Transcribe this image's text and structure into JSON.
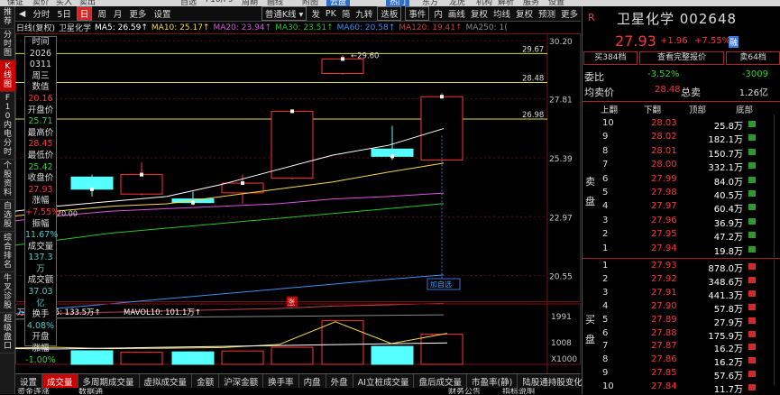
{
  "top_strip": [
    "保证",
    "卖价",
    "买入",
    "卖出",
    "自选",
    "F10/F9",
    "周期",
    "画线",
    "附图",
    "云盘",
    "热门",
    "东方",
    "龙虎",
    "机构",
    "解析",
    "服务",
    "设置"
  ],
  "left_sidebar": [
    "推荐",
    "分时图",
    "K线图",
    "F10内电分时",
    "个股资料",
    "自选股",
    "综合排名",
    "牛叉诊股",
    "超级盘口"
  ],
  "toolbar": {
    "items": [
      "◀",
      "分时",
      "5日",
      "日",
      "周",
      "月",
      "更多",
      "设置"
    ],
    "selected": "日",
    "fq": "普通K线",
    "right": [
      "发",
      "PK",
      "简",
      "九转",
      "迭板",
      "事件",
      "内",
      "画线",
      "复权",
      "均线",
      "复权",
      "预测",
      "更多"
    ]
  },
  "indicators": {
    "label": "日线(复权)",
    "name": "卫星化学",
    "items": [
      {
        "t": "MA5: 26.59↑",
        "c": "#ffffff"
      },
      {
        "t": "MA10: 25.17↑",
        "c": "#f5d84a"
      },
      {
        "t": "MA20: 23.94↑",
        "c": "#e050e0"
      },
      {
        "t": "MA30: 23.51↑",
        "c": "#27c427"
      },
      {
        "t": "MA60: 20.58↑",
        "c": "#3d8ef0"
      },
      {
        "t": "MA120: 19.41↑",
        "c": "#c84040"
      },
      {
        "t": "MA250: 1(",
        "c": "#888888"
      }
    ]
  },
  "price_axis": [
    "30.20",
    "27.81",
    "25.39",
    "22.97",
    "20.55"
  ],
  "price_lines": [
    {
      "label": "29.67",
      "value": 29.67
    },
    {
      "label": "28.48",
      "value": 28.48
    },
    {
      "label": "26.98",
      "value": 26.98
    }
  ],
  "annotations": {
    "high": "29.60",
    "low": "20.00",
    "limit": "涨",
    "add_watch": "加自选"
  },
  "chart_data": {
    "type": "candlestick",
    "candles": [
      {
        "o": 24.6,
        "c": 24.1,
        "h": 24.7,
        "l": 23.8
      },
      {
        "o": 23.9,
        "c": 24.7,
        "h": 25.2,
        "l": 23.85
      },
      {
        "o": 23.7,
        "c": 23.55,
        "h": 24.0,
        "l": 23.45
      },
      {
        "o": 23.95,
        "c": 24.35,
        "h": 24.7,
        "l": 23.5
      },
      {
        "o": 24.55,
        "c": 27.3,
        "h": 27.35,
        "l": 24.5
      },
      {
        "o": 28.85,
        "c": 29.45,
        "h": 29.6,
        "l": 28.8
      },
      {
        "o": 25.75,
        "c": 25.45,
        "h": 26.7,
        "l": 25.3
      },
      {
        "o": 25.3,
        "c": 27.9,
        "h": 28.05,
        "l": 25.2
      }
    ],
    "ma_lines": [
      {
        "name": "MA5",
        "color": "#ffffff",
        "values": [
          23.4,
          23.6,
          23.8,
          24.3,
          24.9,
          25.5,
          25.9,
          26.59
        ]
      },
      {
        "name": "MA10",
        "color": "#f5d84a",
        "values": [
          23.2,
          23.4,
          23.5,
          23.8,
          24.1,
          24.4,
          24.8,
          25.17
        ]
      },
      {
        "name": "MA20",
        "color": "#e050e0",
        "values": [
          23.0,
          23.2,
          23.3,
          23.4,
          23.5,
          23.7,
          23.8,
          23.94
        ]
      },
      {
        "name": "MA30",
        "color": "#27c427",
        "values": [
          22.0,
          22.3,
          22.5,
          22.7,
          22.9,
          23.1,
          23.3,
          23.51
        ]
      },
      {
        "name": "MA60",
        "color": "#3d8ef0",
        "values": [
          19.2,
          19.4,
          19.6,
          19.8,
          20.0,
          20.2,
          20.4,
          20.58
        ]
      },
      {
        "name": "MA120",
        "color": "#c84040",
        "values": [
          19.0,
          19.05,
          19.1,
          19.15,
          19.2,
          19.3,
          19.35,
          19.41
        ]
      },
      {
        "name": "MA250",
        "color": "#888888",
        "values": [
          18.8,
          18.82,
          18.84,
          18.86,
          18.88,
          18.9,
          18.92,
          18.94
        ]
      }
    ],
    "y_range": [
      19.5,
      30.5
    ],
    "volume": {
      "label_suffix": "万",
      "mavol5": "MAVOL5: 133.5万↑",
      "mavol10": "MAVOL10: 101.1万↑",
      "axis": [
        "1991",
        "1008",
        "X1000"
      ],
      "values": [
        62.0,
        55.0,
        57.0,
        61.0,
        78.0,
        199.1,
        82.0,
        137.3
      ],
      "max": 210
    }
  },
  "info_box": [
    {
      "t": "时间",
      "c": "lbl"
    },
    {
      "t": "2026",
      "c": "lbl"
    },
    {
      "t": "0311",
      "c": "lbl"
    },
    {
      "t": "周三",
      "c": "lbl"
    },
    {
      "t": "数值",
      "c": "lbl"
    },
    {
      "t": "20.16",
      "c": "up"
    },
    {
      "t": "开盘价",
      "c": "lbl"
    },
    {
      "t": "25.71",
      "c": "dn"
    },
    {
      "t": "最高价",
      "c": "lbl"
    },
    {
      "t": "28.45",
      "c": "up"
    },
    {
      "t": "最低价",
      "c": "lbl"
    },
    {
      "t": "25.42",
      "c": "dn"
    },
    {
      "t": "收盘价",
      "c": "lbl"
    },
    {
      "t": "27.93",
      "c": "up"
    },
    {
      "t": "涨幅",
      "c": "lbl"
    },
    {
      "t": "+7.55%",
      "c": "up"
    },
    {
      "t": "振幅",
      "c": "lbl"
    },
    {
      "t": "11.67%",
      "c": "cy"
    },
    {
      "t": "成交量",
      "c": "lbl"
    },
    {
      "t": "137.3万",
      "c": "cy"
    },
    {
      "t": "成交额",
      "c": "lbl"
    },
    {
      "t": "37.03亿",
      "c": "cy"
    },
    {
      "t": "换手",
      "c": "lbl"
    },
    {
      "t": "4.08%",
      "c": "cy"
    },
    {
      "t": "开盘",
      "c": "lbl"
    },
    {
      "t": "涨幅",
      "c": "lbl"
    },
    {
      "t": "-1.00%",
      "c": "dn"
    }
  ],
  "bottom_tabs": [
    "设置",
    "成交量",
    "多周期成交量",
    "虚拟成交量",
    "金额",
    "沪深金额",
    "换手率",
    "内盘",
    "外盘",
    "AI立桩成交量",
    "盘后成交量",
    "市盈率(静)",
    "陆股通持股变化"
  ],
  "bottom_tabs_selected": "成交量",
  "bottom2": [
    "资金连涨",
    "数据通",
    "财务公告",
    "指标说明"
  ],
  "right_panel": {
    "title": "卫星化学 002648",
    "price": "27.93",
    "change": "+1.96",
    "pct": "+7.55%",
    "badge": "融",
    "tabs": [
      "买384档",
      "查看完整报价",
      "卖64档"
    ],
    "weibi_label": "委比",
    "weibi_val": "-3.52%",
    "weicha_val": "-3009",
    "avg_label": "均卖价",
    "avg_val": "28.48",
    "total_label": "总卖",
    "total_val": "1.26亿",
    "ob_headers": [
      "上翻",
      "下翻",
      "顶部",
      "底部"
    ],
    "sell_label": "卖盘",
    "buy_label": "买盘",
    "sells": [
      {
        "n": "10",
        "p": "28.03",
        "v": "25.8万"
      },
      {
        "n": "9",
        "p": "28.02",
        "v": "182.1万"
      },
      {
        "n": "8",
        "p": "28.01",
        "v": "150.7万"
      },
      {
        "n": "7",
        "p": "28.00",
        "v": "332.1万"
      },
      {
        "n": "6",
        "p": "27.99",
        "v": "84.0万"
      },
      {
        "n": "5",
        "p": "27.98",
        "v": "40.5万"
      },
      {
        "n": "4",
        "p": "27.97",
        "v": "60.4万"
      },
      {
        "n": "3",
        "p": "27.96",
        "v": "36.9万"
      },
      {
        "n": "2",
        "p": "27.95",
        "v": "47.2万"
      },
      {
        "n": "1",
        "p": "27.94",
        "v": "19.8万"
      }
    ],
    "buys": [
      {
        "n": "1",
        "p": "27.93",
        "v": "878.0万"
      },
      {
        "n": "2",
        "p": "27.92",
        "v": "348.6万"
      },
      {
        "n": "3",
        "p": "27.91",
        "v": "441.3万"
      },
      {
        "n": "4",
        "p": "27.90",
        "v": "57.8万"
      },
      {
        "n": "5",
        "p": "27.89",
        "v": "27.9万"
      },
      {
        "n": "6",
        "p": "27.88",
        "v": "175.9万"
      },
      {
        "n": "7",
        "p": "27.87",
        "v": "16.2万"
      },
      {
        "n": "8",
        "p": "27.86",
        "v": "16.2万"
      },
      {
        "n": "9",
        "p": "27.85",
        "v": "57.6万"
      },
      {
        "n": "10",
        "p": "27.84",
        "v": "11.7万"
      }
    ]
  },
  "colors": {
    "up": "#ff3333",
    "down": "#33cc33",
    "cyan": "#55ffff",
    "accent": "#cc0000"
  }
}
